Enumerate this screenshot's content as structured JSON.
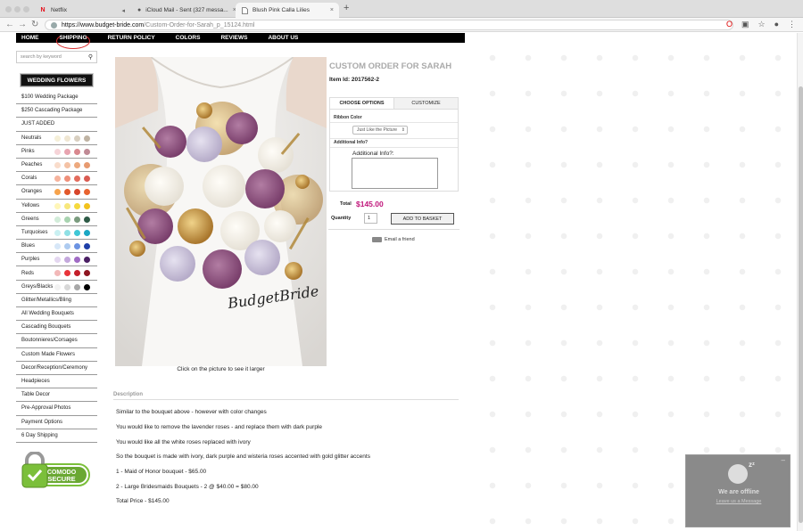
{
  "browser": {
    "tabs": [
      {
        "title": "Netflix",
        "favicon": "N"
      },
      {
        "title": "iCloud Mail - Sent (327 messa...",
        "favicon": "",
        "audio": true
      },
      {
        "title": "Blush Pink Calla Lilies",
        "favicon": "doc"
      }
    ],
    "url_host": "https://www.budget-bride.com",
    "url_path": "/Custom-Order-for-Sarah_p_15124.html"
  },
  "topnav": [
    "HOME",
    "SHIPPING",
    "RETURN POLICY",
    "COLORS",
    "REVIEWS",
    "ABOUT US"
  ],
  "sidebar": {
    "search_placeholder": "search by keyword",
    "header": "WEDDING FLOWERS",
    "items": [
      {
        "label": "$100 Wedding Package",
        "swatches": []
      },
      {
        "label": "$250 Cascading Package",
        "swatches": []
      },
      {
        "label": "JUST ADDED",
        "swatches": []
      },
      {
        "label": "Neutrals",
        "swatches": [
          "#f5efd8",
          "#efe6d2",
          "#d8cfc0",
          "#bfb3a3"
        ]
      },
      {
        "label": "Pinks",
        "swatches": [
          "#f6d4d8",
          "#e8a4b0",
          "#d9888f",
          "#c08a95"
        ]
      },
      {
        "label": "Peaches",
        "swatches": [
          "#f9dccb",
          "#f4c2a5",
          "#eda97e",
          "#e79a70"
        ]
      },
      {
        "label": "Corals",
        "swatches": [
          "#f6b39d",
          "#ef8f7a",
          "#e36c5d",
          "#d95b52"
        ]
      },
      {
        "label": "Oranges",
        "swatches": [
          "#f7a34c",
          "#e2582a",
          "#d7452b",
          "#e8632f"
        ]
      },
      {
        "label": "Yellows",
        "swatches": [
          "#fff6b8",
          "#f7e77c",
          "#f5d93d",
          "#f2c21d"
        ]
      },
      {
        "label": "Greens",
        "swatches": [
          "#d2ecd9",
          "#a8d3b0",
          "#7a9b7e",
          "#2d5a46"
        ]
      },
      {
        "label": "Turquoises",
        "swatches": [
          "#c9f0f2",
          "#8fe0e5",
          "#3fc7d6",
          "#1aa7c4"
        ]
      },
      {
        "label": "Blues",
        "swatches": [
          "#d7e7f8",
          "#aecbf0",
          "#6c93e2",
          "#1e3fa8"
        ]
      },
      {
        "label": "Purples",
        "swatches": [
          "#e4d7f0",
          "#c4a8dc",
          "#a06bc4",
          "#4a1f63"
        ]
      },
      {
        "label": "Reds",
        "swatches": [
          "#f2b8b8",
          "#e8343a",
          "#c41e2a",
          "#8e1520"
        ]
      },
      {
        "label": "Greys/Blacks",
        "swatches": [
          "#f2f2f2",
          "#d8d8d8",
          "#a8a8a8",
          "#000000"
        ]
      },
      {
        "label": "Glitter/Metallics/Bling",
        "swatches": []
      },
      {
        "label": "All Wedding Bouquets",
        "swatches": []
      },
      {
        "label": "Cascading Bouquets",
        "swatches": []
      },
      {
        "label": "Boutonnieres/Corsages",
        "swatches": []
      },
      {
        "label": "Custom Made Flowers",
        "swatches": []
      },
      {
        "label": "Decor/Reception/Ceremony",
        "swatches": []
      },
      {
        "label": "Headpieces",
        "swatches": []
      },
      {
        "label": "Table Decor",
        "swatches": []
      },
      {
        "label": "Pre-Approval Photos",
        "swatches": []
      },
      {
        "label": "Payment Options",
        "swatches": []
      },
      {
        "label": "6 Day Shipping",
        "swatches": []
      }
    ],
    "badge": {
      "line1": "COMODO",
      "line2": "SECURE"
    }
  },
  "product": {
    "photo_watermark": "BudgetBride",
    "photo_caption": "Click on the picture to see it larger",
    "title": "CUSTOM ORDER FOR SARAH",
    "item_id": "Item Id: 2017562-2",
    "tabs": {
      "options": "CHOOSE OPTIONS",
      "customize": "CUSTOMIZE"
    },
    "ribbon_label": "Ribbon Color",
    "ribbon_value": "Just Like the Picture",
    "additional_label": "Additional Info?",
    "additional_field_label": "Additional Info?:",
    "total_label": "Total",
    "price": "$145.00",
    "quantity_label": "Quantity",
    "quantity": "1",
    "add_button": "ADD TO BASKET",
    "email_friend": "Email a friend"
  },
  "description": {
    "heading": "Description",
    "paragraphs": [
      "Similar to the bouquet above - however with color changes",
      "You would like to remove the lavender roses - and replace them with dark purple",
      "You would like all the white roses replaced with ivory",
      "So the bouquet is made with ivory, dark purple and wisteria roses accented with gold glitter accents",
      "1 - Maid of Honor bouquet - $65.00",
      "2 - Large Bridesmaids Bouquets - 2 @ $40.00 = $80.00",
      "Total Price - $145.00"
    ]
  },
  "chat": {
    "status": "We are offline",
    "link": "Leave us a Message",
    "minimize": "–",
    "sleep": "zᶻ"
  },
  "colors": {
    "accent_price": "#c0157a"
  }
}
